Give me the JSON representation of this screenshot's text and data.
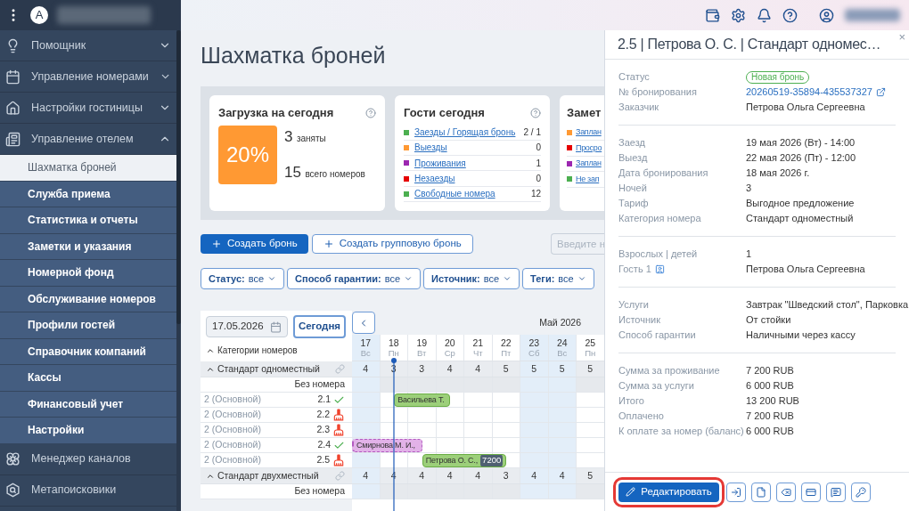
{
  "sidebar": {
    "avatar": "A",
    "items": [
      {
        "label": "Помощник",
        "expanded": false
      },
      {
        "label": "Управление номерами",
        "expanded": false
      },
      {
        "label": "Настройки гостиницы",
        "expanded": false
      },
      {
        "label": "Управление отелем",
        "expanded": true,
        "children": [
          {
            "label": "Шахматка броней",
            "selected": true
          },
          {
            "label": "Служба приема",
            "selected": false
          },
          {
            "label": "Статистика и отчеты",
            "selected": false
          },
          {
            "label": "Заметки и указания",
            "selected": false
          },
          {
            "label": "Номерной фонд",
            "selected": false
          },
          {
            "label": "Обслуживание номеров",
            "selected": false
          },
          {
            "label": "Профили гостей",
            "selected": false
          },
          {
            "label": "Справочник компаний",
            "selected": false
          },
          {
            "label": "Кассы",
            "selected": false
          },
          {
            "label": "Финансовый учет",
            "selected": false
          },
          {
            "label": "Настройки",
            "selected": false
          }
        ]
      },
      {
        "label": "Менеджер каналов"
      },
      {
        "label": "Метапоисковики"
      }
    ]
  },
  "page": {
    "title": "Шахматка броней"
  },
  "load_card": {
    "title": "Загрузка на сегодня",
    "percent": "20%",
    "occupied": "3",
    "occupied_label": "заняты",
    "total": "15",
    "total_label": "всего номеров"
  },
  "guests_card": {
    "title": "Гости сегодня",
    "items": [
      {
        "label": "Заезды / Горящая бронь",
        "value": "2 / 1",
        "color": "#4caf50"
      },
      {
        "label": "Выезды",
        "value": "0",
        "color": "#ff9933"
      },
      {
        "label": "Проживания",
        "value": "1",
        "color": "#9c27b0"
      },
      {
        "label": "Незаезды",
        "value": "0",
        "color": "#e60000"
      },
      {
        "label": "Свободные номера",
        "value": "12",
        "color": "#4caf50"
      }
    ]
  },
  "notes_card": {
    "title": "Замет",
    "items": [
      {
        "label": "Заплан",
        "color": "#ff9933"
      },
      {
        "label": "Просро",
        "color": "#e60000"
      },
      {
        "label": "Заплан",
        "color": "#9c27b0"
      },
      {
        "label": "Не зап",
        "color": "#4caf50"
      }
    ]
  },
  "actions": [
    {
      "label": "Создать бронь",
      "kind": "primary"
    },
    {
      "label": "Создать групповую бронь",
      "kind": "secondary"
    }
  ],
  "search": {
    "placeholder": "Введите н"
  },
  "filters": [
    {
      "label": "Статус:",
      "value": "все"
    },
    {
      "label": "Способ гарантии:",
      "value": "все"
    },
    {
      "label": "Источник:",
      "value": "все"
    },
    {
      "label": "Теги:",
      "value": "все"
    }
  ],
  "calendar": {
    "date": "17.05.2026",
    "today_button": "Сегодня",
    "month": "Май 2026",
    "categories_header": "Категории номеров",
    "days": [
      {
        "day": "17",
        "weekday": "Вс",
        "weekend": true,
        "today": false
      },
      {
        "day": "18",
        "weekday": "Пн",
        "weekend": false,
        "today": true
      },
      {
        "day": "19",
        "weekday": "Вт",
        "weekend": false,
        "today": false
      },
      {
        "day": "20",
        "weekday": "Ср",
        "weekend": false,
        "today": false
      },
      {
        "day": "21",
        "weekday": "Чт",
        "weekend": false,
        "today": false
      },
      {
        "day": "22",
        "weekday": "Пт",
        "weekend": false,
        "today": false
      },
      {
        "day": "23",
        "weekday": "Сб",
        "weekend": true,
        "today": false
      },
      {
        "day": "24",
        "weekday": "Вс",
        "weekend": true,
        "today": false
      },
      {
        "day": "25",
        "weekday": "Пн",
        "weekend": false,
        "today": false
      }
    ],
    "categories": [
      {
        "name": "Стандарт одноместный",
        "expanded": true,
        "counts": [
          "4",
          "3",
          "3",
          "4",
          "4",
          "5",
          "5",
          "5",
          "5"
        ],
        "rows": [
          {
            "kind": "unassigned",
            "label": "Без номера"
          },
          {
            "kind": "room",
            "floor": "2 (Основной)",
            "number": "2.1",
            "clean": true,
            "booking": {
              "guest": "Васильева Т.",
              "continues_left": false,
              "color": "#9ccf7a"
            },
            "cells": [
              {
                "kind": "free"
              },
              {
                "kind": "start"
              },
              {
                "kind": "stay"
              },
              {
                "kind": "end"
              },
              {
                "kind": "free"
              },
              {
                "kind": "free"
              },
              {
                "kind": "free"
              },
              {
                "kind": "free"
              },
              {
                "kind": "free"
              }
            ]
          },
          {
            "kind": "room",
            "floor": "2 (Основной)",
            "number": "2.2",
            "clean": false
          },
          {
            "kind": "room",
            "floor": "2 (Основной)",
            "number": "2.3",
            "clean": false
          },
          {
            "kind": "room",
            "floor": "2 (Основной)",
            "number": "2.4",
            "clean": true,
            "booking": {
              "guest": "Смирнова М. И.,",
              "continues_left": true,
              "color": "#e2b2e8"
            },
            "cells": [
              {
                "kind": "stay"
              },
              {
                "kind": "stay"
              },
              {
                "kind": "end"
              },
              {
                "kind": "free"
              },
              {
                "kind": "free"
              },
              {
                "kind": "free"
              },
              {
                "kind": "free"
              },
              {
                "kind": "free"
              },
              {
                "kind": "free"
              }
            ]
          },
          {
            "kind": "room",
            "floor": "2 (Основной)",
            "number": "2.5",
            "clean": false,
            "booking": {
              "guest": "Петрова О. С.,",
              "amount": "7200",
              "continues_left": false,
              "color": "#9ccf7a"
            },
            "cells": [
              {
                "kind": "free"
              },
              {
                "kind": "free"
              },
              {
                "kind": "start"
              },
              {
                "kind": "stay"
              },
              {
                "kind": "stay"
              },
              {
                "kind": "end"
              },
              {
                "kind": "free"
              },
              {
                "kind": "free"
              },
              {
                "kind": "free"
              }
            ]
          }
        ]
      },
      {
        "name": "Стандарт двухместный",
        "expanded": true,
        "counts": [
          "4",
          "4",
          "4",
          "4",
          "4",
          "3",
          "4",
          "4",
          "5"
        ],
        "rows": [
          {
            "kind": "unassigned",
            "label": "Без номера"
          }
        ]
      }
    ]
  },
  "panel": {
    "title": "2.5 | Петрова О. С. | Стандарт одномес…",
    "close": "×",
    "sections": [
      [
        {
          "label": "Статус",
          "value": "Новая бронь",
          "kind": "badge"
        },
        {
          "label": "№ бронирования",
          "value": "20260519-35894-435537327",
          "kind": "link"
        },
        {
          "label": "Заказчик",
          "value": "Петрова Ольга Сергеевна",
          "kind": "text"
        }
      ],
      [
        {
          "label": "Заезд",
          "value": "19 мая 2026 (Вт) - 14:00",
          "kind": "text"
        },
        {
          "label": "Выезд",
          "value": "22 мая 2026 (Пт) - 12:00",
          "kind": "text"
        },
        {
          "label": "Дата бронирования",
          "value": "18 мая 2026 г.",
          "kind": "text"
        },
        {
          "label": "Ночей",
          "value": "3",
          "kind": "text"
        },
        {
          "label": "Тариф",
          "value": "Выгодное предложение",
          "kind": "text"
        },
        {
          "label": "Категория номера",
          "value": "Стандарт одноместный",
          "kind": "text"
        }
      ],
      [
        {
          "label": "Взрослых | детей",
          "value": "1",
          "kind": "text"
        },
        {
          "label": "Гость 1",
          "value": "Петрова Ольга Сергеевна",
          "kind": "guest"
        }
      ],
      [
        {
          "label": "Услуги",
          "value": "Завтрак \"Шведский стол\", Парковка",
          "kind": "text"
        },
        {
          "label": "Источник",
          "value": "От стойки",
          "kind": "text"
        },
        {
          "label": "Способ гарантии",
          "value": "Наличными через кассу",
          "kind": "text"
        }
      ],
      [
        {
          "label": "Сумма за проживание",
          "value": "7 200 RUB",
          "kind": "text"
        },
        {
          "label": "Сумма за услуги",
          "value": "6 000 RUB",
          "kind": "text"
        },
        {
          "label": "Итого",
          "value": "13 200 RUB",
          "kind": "text"
        },
        {
          "label": "Оплачено",
          "value": "7 200 RUB",
          "kind": "text"
        },
        {
          "label": "К оплате за номер (баланс)",
          "value": "6 000 RUB",
          "kind": "text"
        }
      ]
    ],
    "edit_button": {
      "label": "Редактировать",
      "highlighted": true
    }
  }
}
